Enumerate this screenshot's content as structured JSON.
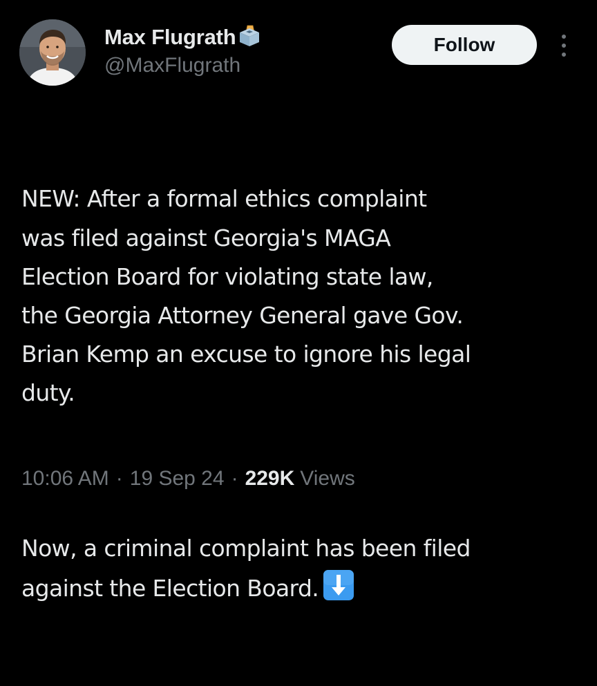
{
  "tweet": {
    "author": {
      "display_name": "Max Flugrath",
      "handle": "@MaxFlugrath",
      "avatar_icon": "profile-photo",
      "badge_icon": "ballot-box-icon"
    },
    "follow_label": "Follow",
    "more_icon": "more-vertical-icon",
    "text": {
      "paragraph_1": "NEW: After a formal ethics complaint\nwas filed against Georgia's MAGA\nElection Board for violating state law,\nthe Georgia Attorney General gave Gov.\nBrian Kemp an excuse to ignore his legal\nduty.",
      "paragraph_2": "Now, a criminal complaint has been filed\nagainst the Election Board.",
      "emoji_icon": "down-arrow-emoji-icon"
    },
    "meta": {
      "time": "10:06 AM",
      "date": "19 Sep 24",
      "views_count": "229K",
      "views_label": "Views",
      "separator": "·"
    }
  },
  "colors": {
    "background": "#000000",
    "primary_text": "#e7e9ea",
    "secondary_text": "#71767b",
    "follow_button_bg": "#eff3f4",
    "follow_button_text": "#0f1419",
    "emoji_blue": "#3b9bf0"
  }
}
